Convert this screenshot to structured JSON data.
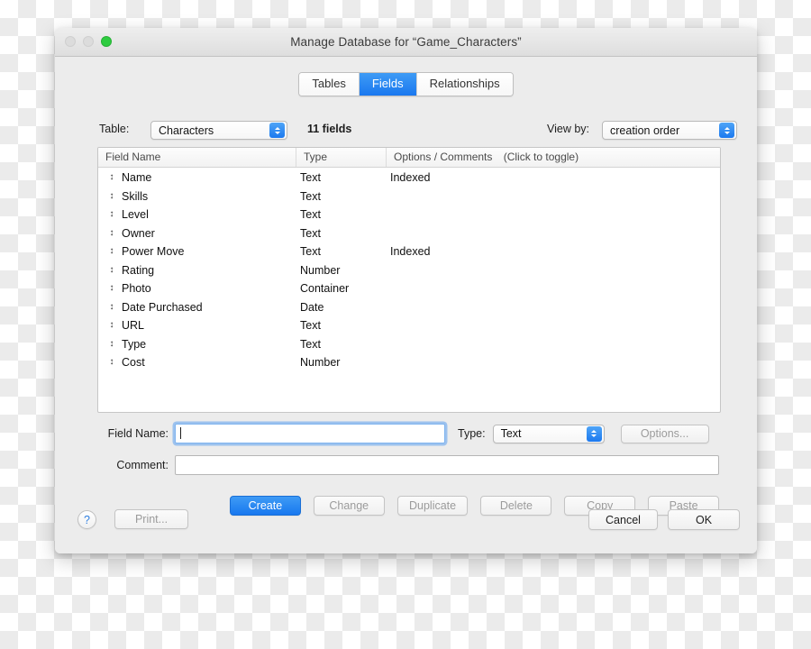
{
  "window": {
    "title": "Manage Database for “Game_Characters”",
    "traffic_lights": {
      "close": "close-button",
      "minimize": "minimize-button",
      "zoom": "zoom-button",
      "zoom_color": "#2ecc40",
      "inactive_color": "#dcdcdc"
    }
  },
  "tabs": [
    {
      "label": "Tables",
      "active": false
    },
    {
      "label": "Fields",
      "active": true
    },
    {
      "label": "Relationships",
      "active": false
    }
  ],
  "accent_color": "#1a78ef",
  "toolbar": {
    "table_label": "Table:",
    "table_value": "Characters",
    "field_count": "11 fields",
    "view_by_label": "View by:",
    "view_by_value": "creation order"
  },
  "field_list": {
    "columns": [
      "Field Name",
      "Type",
      "Options / Comments"
    ],
    "options_hint": "(Click to toggle)",
    "rows": [
      {
        "name": "Name",
        "type": "Text",
        "options": "Indexed"
      },
      {
        "name": "Skills",
        "type": "Text",
        "options": ""
      },
      {
        "name": "Level",
        "type": "Text",
        "options": ""
      },
      {
        "name": "Owner",
        "type": "Text",
        "options": ""
      },
      {
        "name": "Power Move",
        "type": "Text",
        "options": "Indexed"
      },
      {
        "name": "Rating",
        "type": "Number",
        "options": ""
      },
      {
        "name": "Photo",
        "type": "Container",
        "options": ""
      },
      {
        "name": "Date Purchased",
        "type": "Date",
        "options": ""
      },
      {
        "name": "URL",
        "type": "Text",
        "options": ""
      },
      {
        "name": "Type",
        "type": "Text",
        "options": ""
      },
      {
        "name": "Cost",
        "type": "Number",
        "options": ""
      }
    ]
  },
  "form": {
    "field_name_label": "Field Name:",
    "field_name_value": "",
    "type_label": "Type:",
    "type_value": "Text",
    "options_button": "Options...",
    "comment_label": "Comment:",
    "comment_value": ""
  },
  "actions": [
    {
      "label": "Create",
      "enabled": true,
      "primary": true
    },
    {
      "label": "Change",
      "enabled": false,
      "primary": false
    },
    {
      "label": "Duplicate",
      "enabled": false,
      "primary": false
    },
    {
      "label": "Delete",
      "enabled": false,
      "primary": false
    },
    {
      "label": "Copy",
      "enabled": false,
      "primary": false
    },
    {
      "label": "Paste",
      "enabled": false,
      "primary": false
    }
  ],
  "footer": {
    "help": "?",
    "print": "Print...",
    "cancel": "Cancel",
    "ok": "OK"
  }
}
